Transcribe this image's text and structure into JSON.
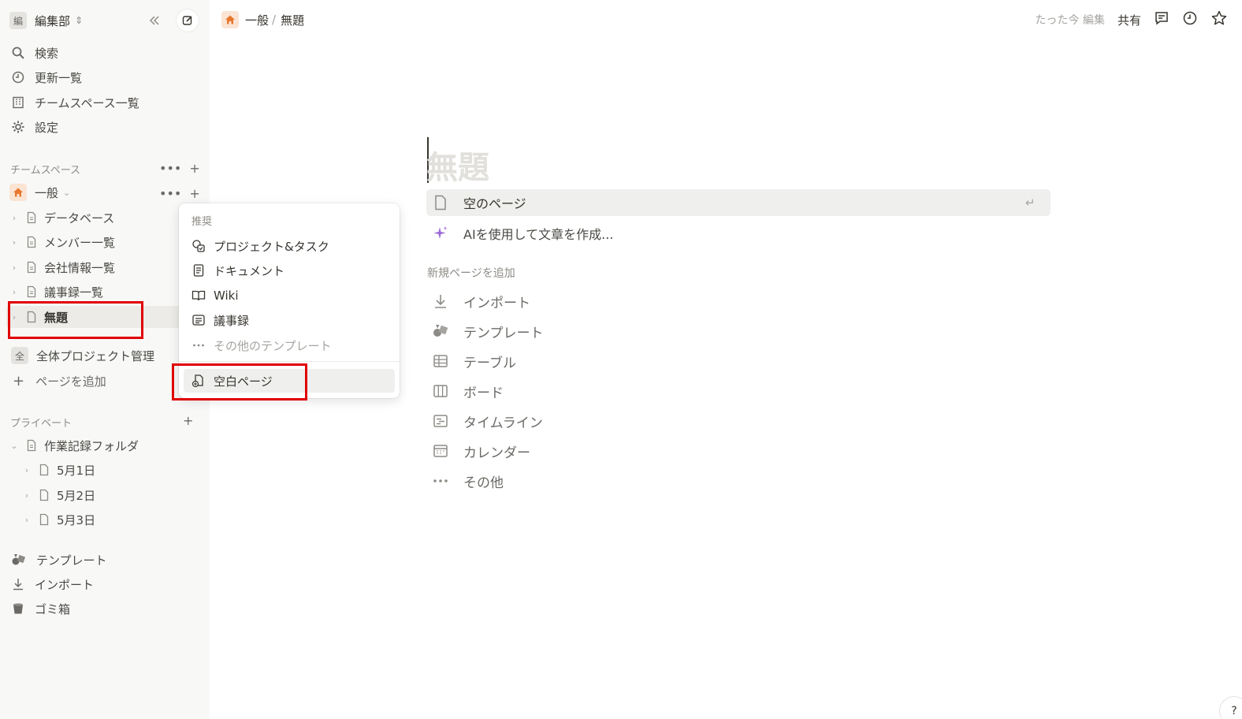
{
  "workspace": {
    "badge": "編",
    "name": "編集部"
  },
  "nav": {
    "search": "検索",
    "updates": "更新一覧",
    "teamspaces": "チームスペース一覧",
    "settings": "設定"
  },
  "teamspace_section": {
    "label": "チームスペース",
    "general": "一般",
    "items": [
      "データベース",
      "メンバー一覧",
      "会社情報一覧",
      "議事録一覧",
      "無題"
    ],
    "all_projects_badge": "全",
    "all_projects": "全体プロジェクト管理",
    "add_page": "ページを追加"
  },
  "private_section": {
    "label": "プライベート",
    "folder": "作業記録フォルダ",
    "children": [
      "5月1日",
      "5月2日",
      "5月3日"
    ]
  },
  "sidebar_bottom": {
    "templates": "テンプレート",
    "import": "インポート",
    "trash": "ゴミ箱"
  },
  "header": {
    "breadcrumb_parent": "一般",
    "breadcrumb_sep": "/",
    "breadcrumb_current": "無題",
    "edited": "たった今 編集",
    "share": "共有"
  },
  "content": {
    "title_placeholder": "無題",
    "empty_page": "空のページ",
    "ai_write": "AIを使用して文章を作成...",
    "add_new_label": "新規ページを追加",
    "add_items": [
      "インポート",
      "テンプレート",
      "テーブル",
      "ボード",
      "タイムライン",
      "カレンダー",
      "その他"
    ]
  },
  "popup": {
    "label": "推奨",
    "items": [
      "プロジェクト&タスク",
      "ドキュメント",
      "Wiki",
      "議事録"
    ],
    "more_templates": "その他のテンプレート",
    "blank_page": "空白ページ"
  },
  "help": "?",
  "colors": {
    "accent_home": "#e8772e",
    "highlight_red": "#e00000",
    "sidebar_bg": "#f8f8f7"
  }
}
